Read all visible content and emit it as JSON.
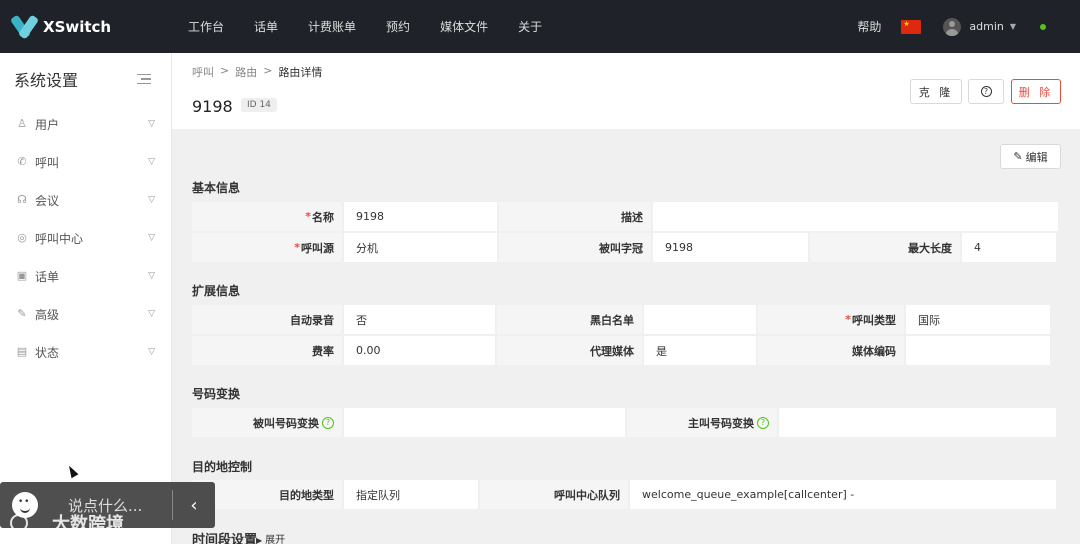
{
  "app": {
    "name": "XSwitch"
  },
  "nav": [
    "工作台",
    "话单",
    "计费账单",
    "预约",
    "媒体文件",
    "关于"
  ],
  "topright": {
    "help": "帮助",
    "user": "admin"
  },
  "sidebar": {
    "title": "系统设置",
    "items": [
      {
        "label": "用户",
        "icon": "user-icon"
      },
      {
        "label": "呼叫",
        "icon": "phone-icon"
      },
      {
        "label": "会议",
        "icon": "meeting-icon"
      },
      {
        "label": "呼叫中心",
        "icon": "callcenter-icon"
      },
      {
        "label": "话单",
        "icon": "cdr-icon"
      },
      {
        "label": "高级",
        "icon": "wrench-icon"
      },
      {
        "label": "状态",
        "icon": "status-icon"
      }
    ]
  },
  "breadcrumb": [
    "呼叫",
    "路由",
    "路由详情"
  ],
  "page": {
    "title": "9198",
    "id_badge": "ID 14"
  },
  "buttons": {
    "clone": "克 隆",
    "delete": "删 除",
    "edit": "编辑"
  },
  "sections": {
    "basic": {
      "title": "基本信息",
      "rows": [
        [
          {
            "k": "名称",
            "req": true,
            "v": "9198"
          },
          {
            "k": "描述",
            "v": ""
          }
        ],
        [
          {
            "k": "呼叫源",
            "req": true,
            "v": "分机"
          },
          {
            "k": "被叫字冠",
            "v": "9198"
          },
          {
            "k": "最大长度",
            "v": "4"
          }
        ]
      ]
    },
    "ext": {
      "title": "扩展信息",
      "rows": [
        [
          {
            "k": "自动录音",
            "v": "否"
          },
          {
            "k": "黑白名单",
            "v": ""
          },
          {
            "k": "呼叫类型",
            "req": true,
            "v": "国际"
          }
        ],
        [
          {
            "k": "费率",
            "v": "0.00"
          },
          {
            "k": "代理媒体",
            "v": "是"
          },
          {
            "k": "媒体编码",
            "v": ""
          }
        ]
      ]
    },
    "num": {
      "title": "号码变换",
      "rows": [
        [
          {
            "k": "被叫号码变换",
            "help": true,
            "v": ""
          },
          {
            "k": "主叫号码变换",
            "help": true,
            "v": ""
          }
        ]
      ]
    },
    "dest": {
      "title": "目的地控制",
      "rows": [
        [
          {
            "k": "目的地类型",
            "v": "指定队列"
          },
          {
            "k": "呼叫中心队列",
            "v": "welcome_queue_example[callcenter] -"
          }
        ]
      ]
    },
    "time": {
      "title": "时间段设置",
      "expand": "展开"
    }
  },
  "chat": {
    "placeholder": "说点什么..."
  },
  "watermark": "大数跨境"
}
